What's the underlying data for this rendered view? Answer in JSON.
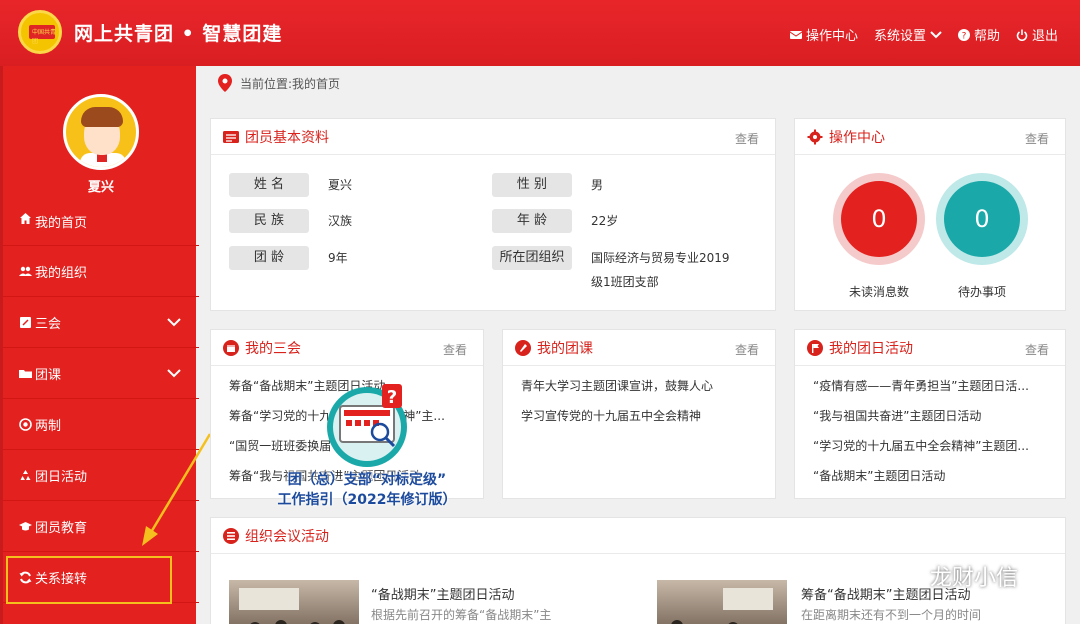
{
  "header": {
    "logo_text": "中国共青团",
    "title": "网上共青团 • 智慧团建",
    "nav": [
      {
        "label": "操作中心",
        "icon": "envelope-icon"
      },
      {
        "label": "系统设置",
        "icon": "chevron-down-icon"
      },
      {
        "label": "帮助",
        "icon": "question-icon"
      },
      {
        "label": "退出",
        "icon": "power-icon"
      }
    ]
  },
  "sidebar": {
    "username": "夏兴",
    "items": [
      {
        "label": "我的首页",
        "icon": "home-icon"
      },
      {
        "label": "我的组织",
        "icon": "users-icon"
      },
      {
        "label": "三会",
        "icon": "edit-icon",
        "expandable": true
      },
      {
        "label": "团课",
        "icon": "folder-icon",
        "expandable": true
      },
      {
        "label": "两制",
        "icon": "target-icon"
      },
      {
        "label": "团日活动",
        "icon": "recycle-icon"
      },
      {
        "label": "团员教育",
        "icon": "graduation-icon"
      },
      {
        "label": "关系接转",
        "icon": "refresh-icon"
      }
    ]
  },
  "breadcrumb": "当前位置:我的首页",
  "profile": {
    "title": "团员基本资料",
    "more": "查看",
    "fields": [
      {
        "label": "姓 名",
        "value": "夏兴"
      },
      {
        "label": "性 别",
        "value": "男"
      },
      {
        "label": "民 族",
        "value": "汉族"
      },
      {
        "label": "年 龄",
        "value": "22岁"
      },
      {
        "label": "团 龄",
        "value": "9年"
      },
      {
        "label": "所在团组织",
        "value1": "国际经济与贸易专业2019",
        "value2": "级1班团支部"
      }
    ]
  },
  "ops": {
    "title": "操作中心",
    "more": "查看",
    "unread": {
      "value": "0",
      "label": "未读消息数"
    },
    "todo": {
      "value": "0",
      "label": "待办事项"
    }
  },
  "sanhui": {
    "title": "我的三会",
    "more": "查看",
    "items": [
      "筹备“备战期末”主题团日活动",
      "筹备“学习党的十九届五中全会精神”主...",
      "“国贸一班班委换届",
      "筹备“我与祖国共奋进”主题团日活动"
    ]
  },
  "tuanke": {
    "title": "我的团课",
    "more": "查看",
    "items": [
      "青年大学习主题团课宣讲，鼓舞人心",
      "学习宣传党的十九届五中全会精神"
    ]
  },
  "tuanri": {
    "title": "我的团日活动",
    "more": "查看",
    "items": [
      "“疫情有感——青年勇担当”主题团日活...",
      "“我与祖国共奋进”主题团日活动",
      "“学习党的十九届五中全会精神”主题团...",
      "“备战期末”主题团日活动"
    ]
  },
  "meetings": {
    "title": "组织会议活动",
    "items": [
      {
        "title": "“备战期末”主题团日活动",
        "desc": "根据先前召开的筹备“备战期末”主"
      },
      {
        "title": "筹备“备战期末”主题团日活动",
        "desc": "在距离期末还有不到一个月的时间"
      }
    ]
  },
  "overlay": {
    "line1": "团（总）支部“对标定级”",
    "line2": "工作指引（2022年修订版）"
  },
  "watermark": "龙财小信",
  "colors": {
    "primary": "#e3211f",
    "accent": "#d8231d",
    "unread": "#e3211f",
    "todo": "#1aa8a8",
    "highlight": "#f5c01d"
  }
}
